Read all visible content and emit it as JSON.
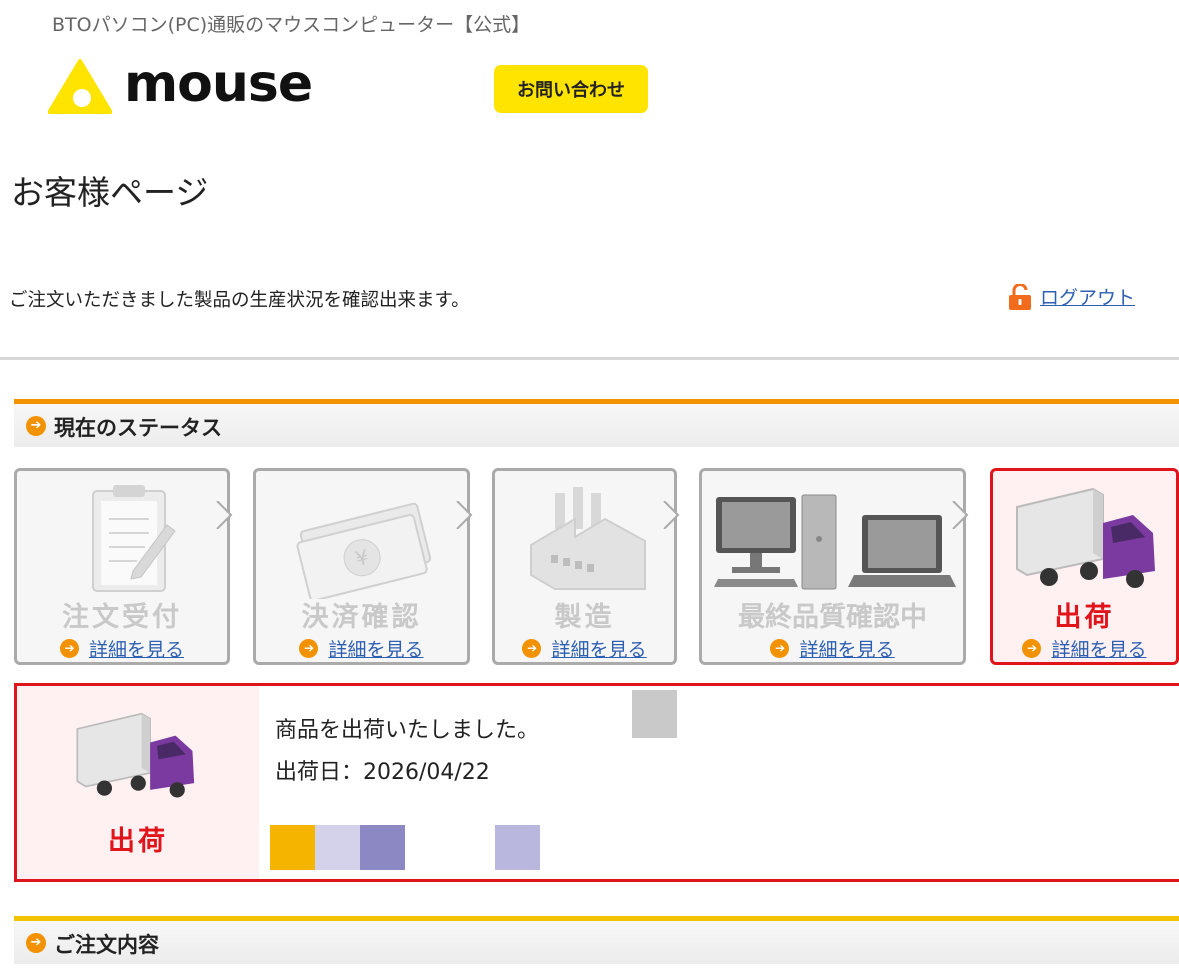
{
  "header": {
    "tagline": "BTOパソコン(PC)通販のマウスコンピューター【公式】",
    "logo_text": "mouse",
    "contact_label": "お問い合わせ"
  },
  "page": {
    "title": "お客様ページ",
    "intro": "ご注文いただきました製品の生産状況を確認出来ます。",
    "logout_label": "ログアウト"
  },
  "status_section": {
    "heading": "現在のステータス",
    "steps": [
      {
        "name": "注文受付",
        "link": "詳細を見る",
        "icon": "clipboard-icon",
        "active": false
      },
      {
        "name": "決済確認",
        "link": "詳細を見る",
        "icon": "money-icon",
        "active": false
      },
      {
        "name": "製造",
        "link": "詳細を見る",
        "icon": "factory-icon",
        "active": false
      },
      {
        "name": "最終品質確認中",
        "link": "詳細を見る",
        "icon": "computers-icon",
        "active": false
      },
      {
        "name": "出荷",
        "link": "詳細を見る",
        "icon": "truck-icon",
        "active": true
      }
    ]
  },
  "detail": {
    "status_name": "出荷",
    "message": "商品を出荷いたしました。",
    "ship_date": "出荷日：2026/04/22"
  },
  "order_section": {
    "heading": "ご注文内容"
  },
  "colors": {
    "accent": "#f29200",
    "active": "#e0151c",
    "link": "#2d5fb3",
    "logo_yellow": "#ffe400"
  }
}
